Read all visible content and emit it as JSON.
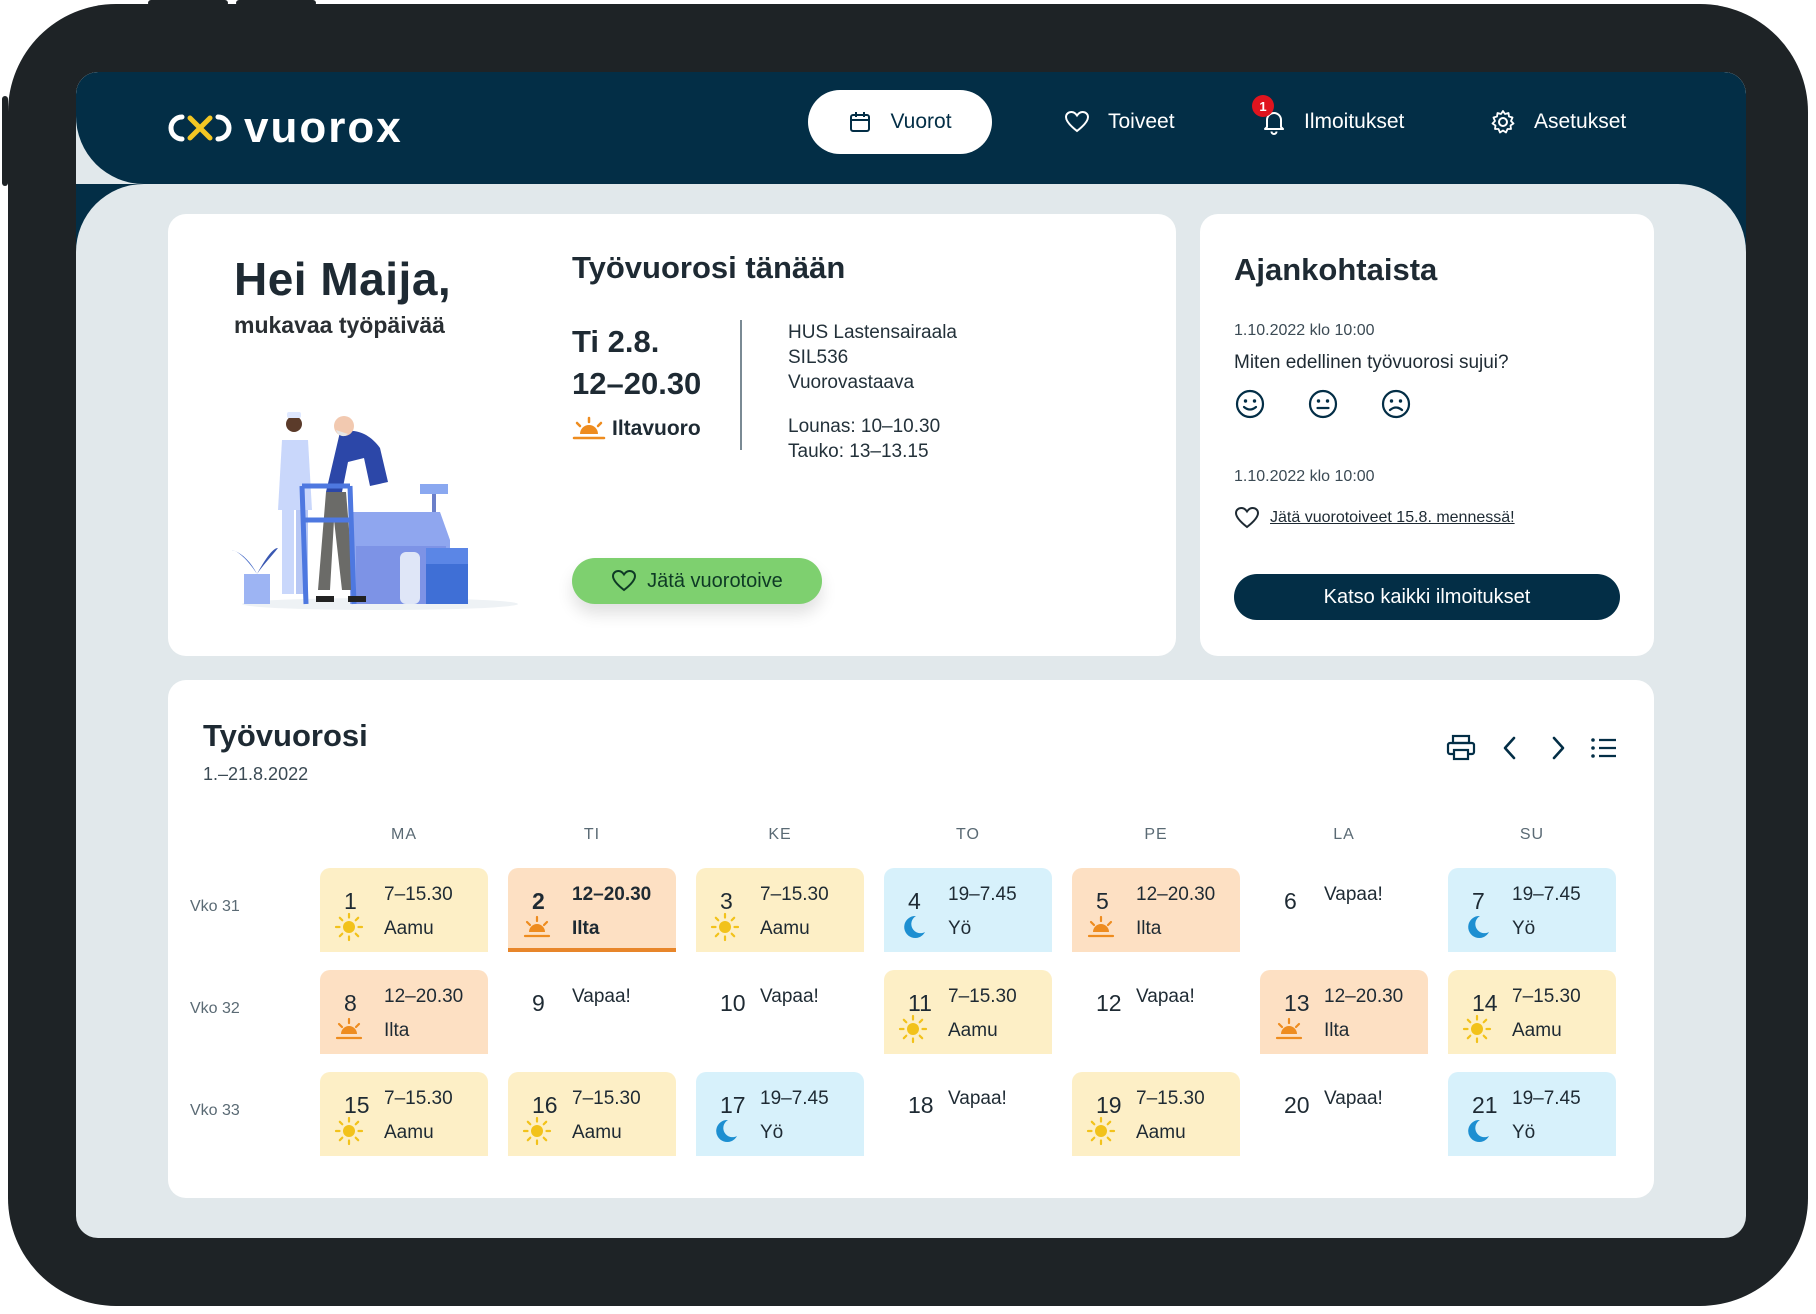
{
  "app": {
    "name": "vuorox"
  },
  "nav": [
    {
      "label": "Vuorot",
      "icon": "calendar-icon",
      "active": true
    },
    {
      "label": "Toiveet",
      "icon": "heart-icon"
    },
    {
      "label": "Ilmoitukset",
      "icon": "bell-icon",
      "badge": "1"
    },
    {
      "label": "Asetukset",
      "icon": "gear-icon"
    }
  ],
  "greeting": {
    "title": "Hei Maija,",
    "subtitle": "mukavaa työpäivää"
  },
  "today": {
    "title": "Työvuorosi tänään",
    "date": "Ti 2.8.",
    "time": "12–20.30",
    "shift": "Iltavuoro",
    "place": "HUS Lastensairaala",
    "unit": "SIL536",
    "role": "Vuorovastaava",
    "lunch": "Lounas: 10–10.30",
    "break": "Tauko: 13–13.15",
    "button": "Jätä vuorotoive"
  },
  "news": {
    "title": "Ajankohtaista",
    "items": [
      {
        "timestamp": "1.10.2022 klo 10:00",
        "text": "Miten edellinen työvuorosi sujui?"
      },
      {
        "timestamp": "1.10.2022 klo 10:00",
        "text": "Jätä vuorotoiveet 15.8. mennessä!"
      }
    ],
    "button": "Katso kaikki ilmoitukset"
  },
  "schedule": {
    "title": "Työvuorosi",
    "range": "1.–21.8.2022",
    "days": [
      "MA",
      "TI",
      "KE",
      "TO",
      "PE",
      "LA",
      "SU"
    ],
    "weeks": [
      {
        "label": "Vko 31",
        "cells": [
          {
            "day": "1",
            "time": "7–15.30",
            "label": "Aamu",
            "type": "aamu"
          },
          {
            "day": "2",
            "time": "12–20.30",
            "label": "Ilta",
            "type": "ilta",
            "today": true
          },
          {
            "day": "3",
            "time": "7–15.30",
            "label": "Aamu",
            "type": "aamu"
          },
          {
            "day": "4",
            "time": "19–7.45",
            "label": "Yö",
            "type": "yo"
          },
          {
            "day": "5",
            "time": "12–20.30",
            "label": "Ilta",
            "type": "ilta"
          },
          {
            "day": "6",
            "time": "Vapaa!",
            "label": "",
            "type": "vapaa"
          },
          {
            "day": "7",
            "time": "19–7.45",
            "label": "Yö",
            "type": "yo"
          }
        ]
      },
      {
        "label": "Vko 32",
        "cells": [
          {
            "day": "8",
            "time": "12–20.30",
            "label": "Ilta",
            "type": "ilta"
          },
          {
            "day": "9",
            "time": "Vapaa!",
            "label": "",
            "type": "vapaa"
          },
          {
            "day": "10",
            "time": "Vapaa!",
            "label": "",
            "type": "vapaa"
          },
          {
            "day": "11",
            "time": "7–15.30",
            "label": "Aamu",
            "type": "aamu"
          },
          {
            "day": "12",
            "time": "Vapaa!",
            "label": "",
            "type": "vapaa"
          },
          {
            "day": "13",
            "time": "12–20.30",
            "label": "Ilta",
            "type": "ilta"
          },
          {
            "day": "14",
            "time": "7–15.30",
            "label": "Aamu",
            "type": "aamu"
          }
        ]
      },
      {
        "label": "Vko 33",
        "cells": [
          {
            "day": "15",
            "time": "7–15.30",
            "label": "Aamu",
            "type": "aamu"
          },
          {
            "day": "16",
            "time": "7–15.30",
            "label": "Aamu",
            "type": "aamu"
          },
          {
            "day": "17",
            "time": "19–7.45",
            "label": "Yö",
            "type": "yo"
          },
          {
            "day": "18",
            "time": "Vapaa!",
            "label": "",
            "type": "vapaa"
          },
          {
            "day": "19",
            "time": "7–15.30",
            "label": "Aamu",
            "type": "aamu"
          },
          {
            "day": "20",
            "time": "Vapaa!",
            "label": "",
            "type": "vapaa"
          },
          {
            "day": "21",
            "time": "19–7.45",
            "label": "Yö",
            "type": "yo"
          }
        ]
      }
    ]
  },
  "colors": {
    "brand": "#032e46",
    "accent_green": "#7ed06f",
    "aamu": "#fdefc6",
    "ilta": "#fde0c3",
    "yo": "#d7f1fb"
  }
}
